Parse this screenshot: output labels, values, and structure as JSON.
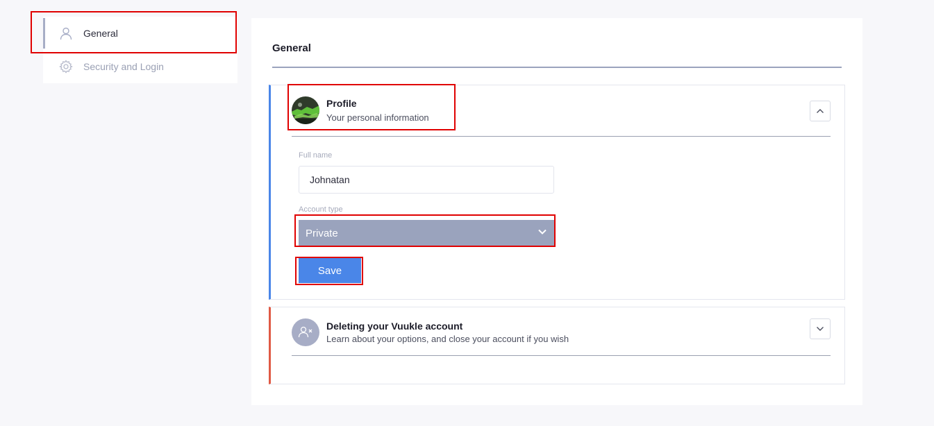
{
  "sidebar": {
    "items": [
      {
        "label": "General",
        "icon": "user-icon",
        "active": true
      },
      {
        "label": "Security and Login",
        "icon": "gear-icon",
        "active": false
      }
    ]
  },
  "main": {
    "title": "General",
    "profile": {
      "title": "Profile",
      "subtitle": "Your personal information",
      "full_name_label": "Full name",
      "full_name_value": "Johnatan",
      "account_type_label": "Account type",
      "account_type_value": "Private",
      "save_label": "Save",
      "toggle_icon": "chevron-up-icon"
    },
    "delete_account": {
      "title": "Deleting your Vuukle account",
      "subtitle": "Learn about your options, and close your account if you wish",
      "toggle_icon": "chevron-down-icon"
    }
  },
  "colors": {
    "accent_blue": "#4a86e8",
    "danger_red": "#e05a45",
    "select_bg": "#9aa3bd",
    "highlight": "#e00000"
  }
}
